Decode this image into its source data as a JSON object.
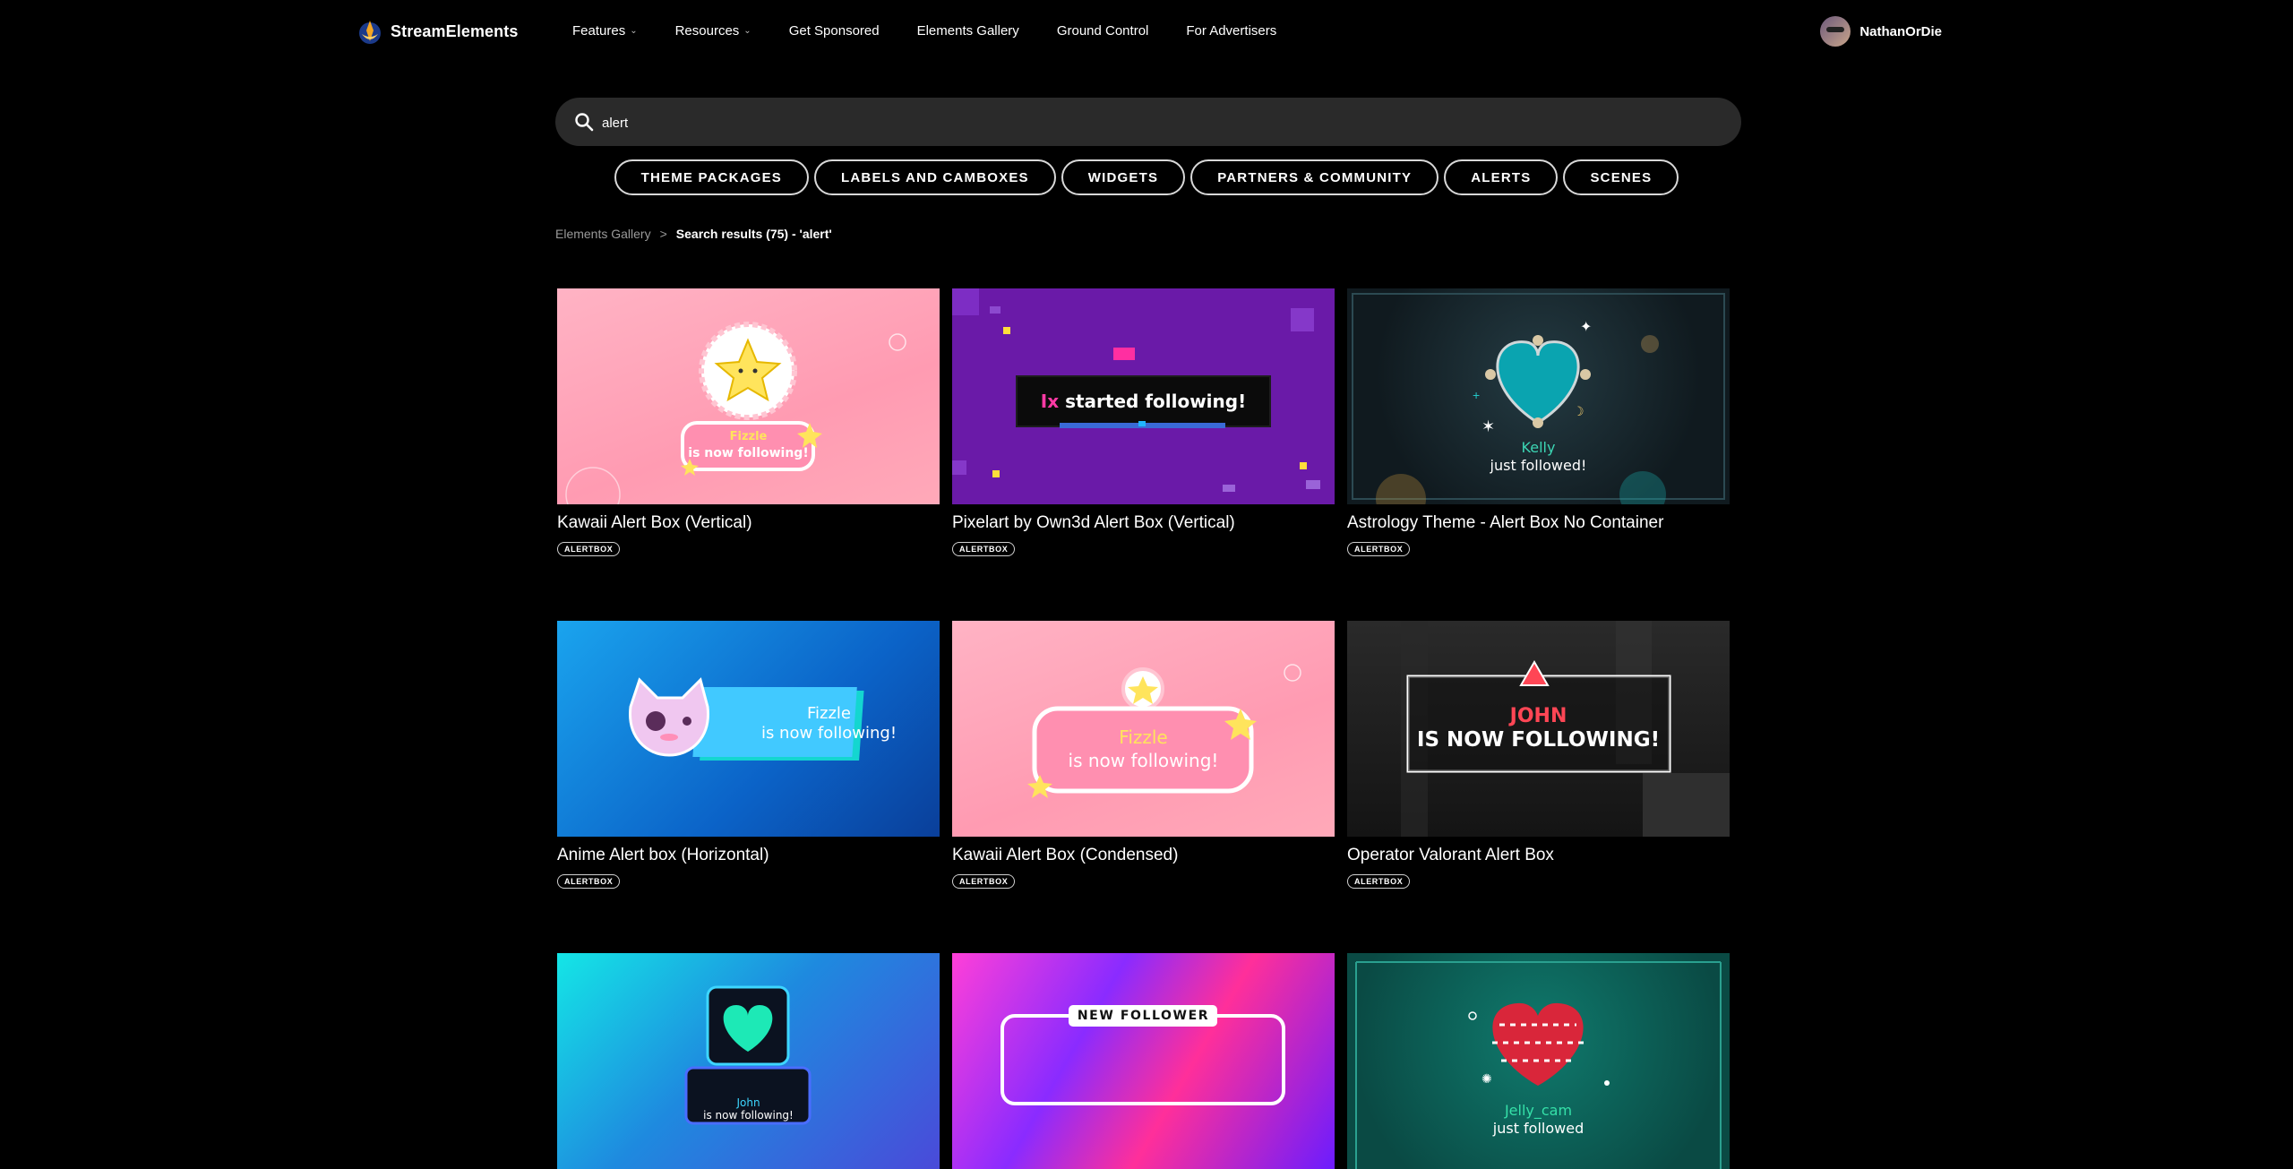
{
  "nav": {
    "logo_text": "StreamElements",
    "items": [
      {
        "label": "Features",
        "has_dropdown": true
      },
      {
        "label": "Resources",
        "has_dropdown": true
      },
      {
        "label": "Get Sponsored",
        "has_dropdown": false
      },
      {
        "label": "Elements Gallery",
        "has_dropdown": false
      },
      {
        "label": "Ground Control",
        "has_dropdown": false
      },
      {
        "label": "For Advertisers",
        "has_dropdown": false
      }
    ],
    "username": "NathanOrDie"
  },
  "search": {
    "value": "alert",
    "icon": "search-icon"
  },
  "categories": [
    "THEME PACKAGES",
    "LABELS AND CAMBOXES",
    "WIDGETS",
    "PARTNERS & COMMUNITY",
    "ALERTS",
    "SCENES"
  ],
  "breadcrumb": {
    "root": "Elements Gallery",
    "separator": ">",
    "current": "Search results (75) - 'alert'"
  },
  "cards": [
    {
      "title": "Kawaii Alert Box (Vertical)",
      "tag": "ALERTBOX",
      "thumb_text": [
        "Fizzle",
        "is now following!"
      ]
    },
    {
      "title": "Pixelart by Own3d Alert Box (Vertical)",
      "tag": "ALERTBOX",
      "thumb_text": [
        "Ix",
        "started following!"
      ]
    },
    {
      "title": "Astrology Theme - Alert Box No Container",
      "tag": "ALERTBOX",
      "thumb_text": [
        "Kelly",
        "just followed!"
      ]
    },
    {
      "title": "Anime Alert box (Horizontal)",
      "tag": "ALERTBOX",
      "thumb_text": [
        "Fizzle",
        "is now following!"
      ]
    },
    {
      "title": "Kawaii Alert Box (Condensed)",
      "tag": "ALERTBOX",
      "thumb_text": [
        "Fizzle",
        "is now following!"
      ]
    },
    {
      "title": "Operator Valorant Alert Box",
      "tag": "ALERTBOX",
      "thumb_text": [
        "JOHN",
        "IS NOW FOLLOWING!"
      ]
    },
    {
      "title": "",
      "tag": "",
      "thumb_text": [
        "John",
        "is now following!"
      ]
    },
    {
      "title": "",
      "tag": "",
      "thumb_text": [
        "NEW FOLLOWER",
        ""
      ]
    },
    {
      "title": "",
      "tag": "",
      "thumb_text": [
        "Jelly_cam",
        "just followed"
      ]
    }
  ]
}
